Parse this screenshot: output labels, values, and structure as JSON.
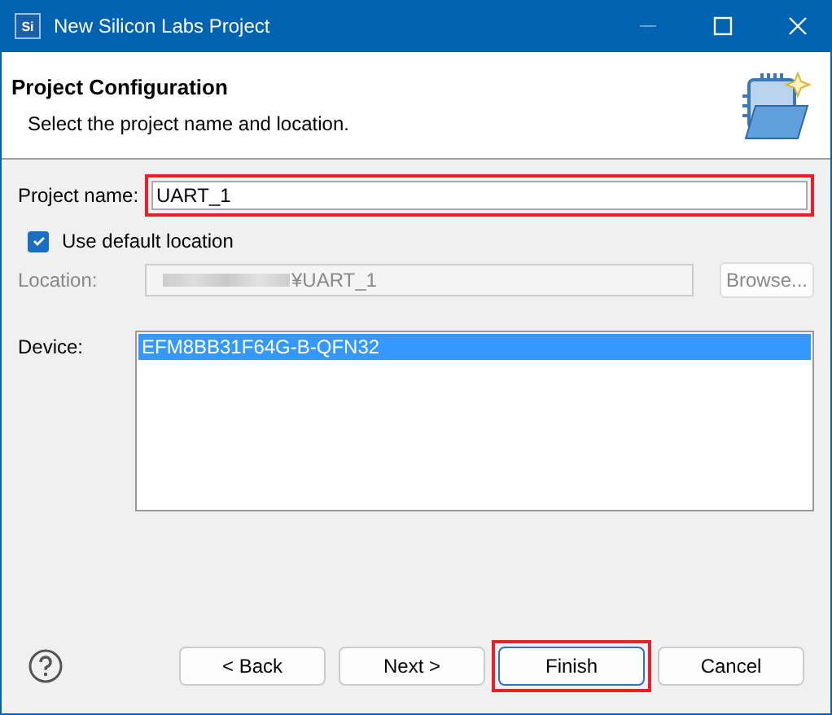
{
  "window": {
    "title": "New Silicon Labs Project",
    "app_icon": "Si"
  },
  "header": {
    "title": "Project Configuration",
    "description": "Select the project name and location."
  },
  "project_name": {
    "label": "Project name:",
    "value": "UART_1",
    "highlighted": true
  },
  "use_default_location": {
    "label": "Use default location",
    "checked": true
  },
  "location": {
    "label": "Location:",
    "value": "¥UART_1",
    "disabled": true,
    "button": "Browse..."
  },
  "device": {
    "label": "Device:",
    "items": [
      {
        "text": "EFM8BB31F64G-B-QFN32",
        "selected": true
      }
    ]
  },
  "buttons": [
    {
      "label": "< Back",
      "highlighted": false,
      "default": false
    },
    {
      "label": "Next >",
      "highlighted": false,
      "default": false
    },
    {
      "label": "Finish",
      "highlighted": true,
      "default": true
    },
    {
      "label": "Cancel",
      "highlighted": false,
      "default": false
    }
  ]
}
